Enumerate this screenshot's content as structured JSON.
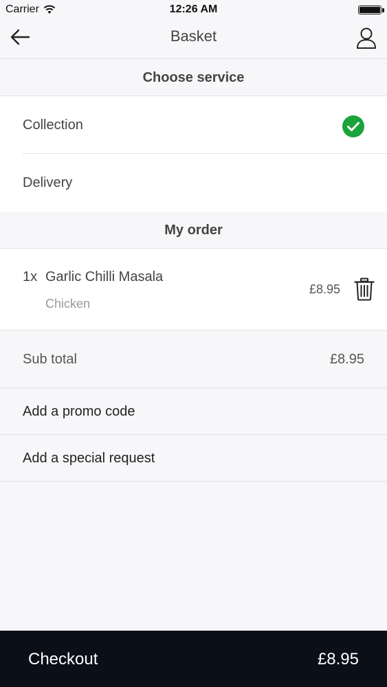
{
  "status_bar": {
    "carrier": "Carrier",
    "time": "12:26 AM",
    "battery_level": 1.0
  },
  "nav": {
    "title": "Basket",
    "back_icon": "arrow-left-icon",
    "profile_icon": "user-icon"
  },
  "service": {
    "header": "Choose service",
    "options": [
      {
        "label": "Collection",
        "selected": true
      },
      {
        "label": "Delivery",
        "selected": false
      }
    ],
    "selected_icon": "check-circle-icon"
  },
  "order": {
    "header": "My order",
    "items": [
      {
        "quantity": "1x",
        "name": "Garlic Chilli Masala",
        "option": "Chicken",
        "price": "£8.95"
      }
    ],
    "remove_icon": "trash-icon"
  },
  "summary": {
    "subtotal_label": "Sub total",
    "subtotal_value": "£8.95",
    "promo_label": "Add a promo code",
    "request_label": "Add a special request"
  },
  "checkout": {
    "label": "Checkout",
    "total": "£8.95"
  },
  "colors": {
    "accent_green": "#1aa43a",
    "checkout_bg": "#0b0f17",
    "page_bg": "#f7f7f9"
  }
}
